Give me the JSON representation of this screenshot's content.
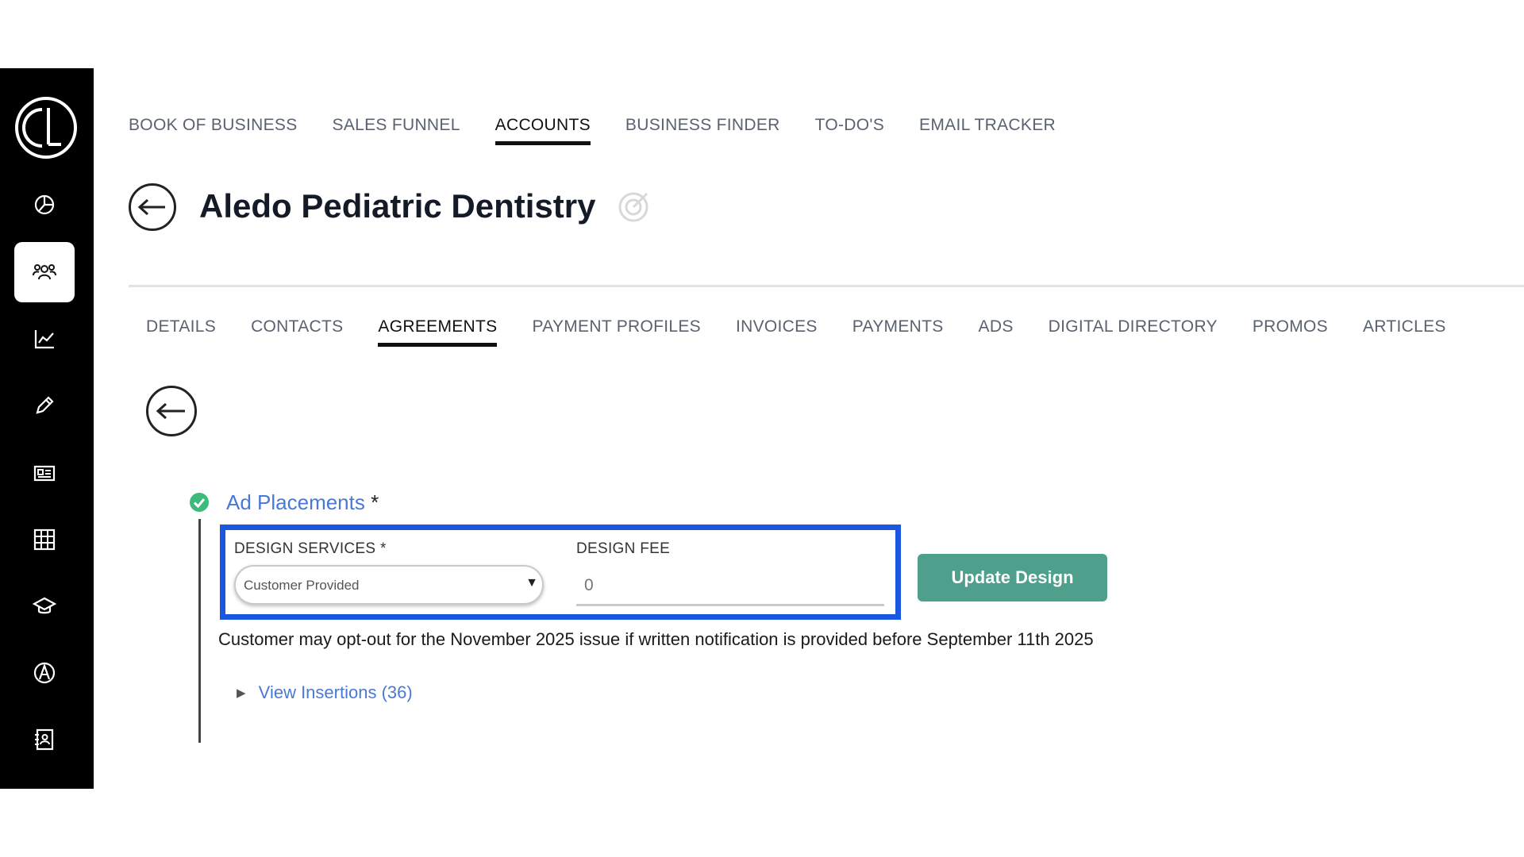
{
  "sidebar": {
    "logo_text": "CL",
    "items": [
      {
        "icon": "pie-chart-icon",
        "active": false
      },
      {
        "icon": "users-icon",
        "active": true
      },
      {
        "icon": "line-chart-icon",
        "active": false
      },
      {
        "icon": "pencil-icon",
        "active": false
      },
      {
        "icon": "newspaper-icon",
        "active": false
      },
      {
        "icon": "grid-icon",
        "active": false
      },
      {
        "icon": "graduation-cap-icon",
        "active": false
      },
      {
        "icon": "compass-icon",
        "active": false
      },
      {
        "icon": "contact-book-icon",
        "active": false
      }
    ]
  },
  "top_nav": {
    "items": [
      "BOOK OF BUSINESS",
      "SALES FUNNEL",
      "ACCOUNTS",
      "BUSINESS FINDER",
      "TO-DO'S",
      "EMAIL TRACKER"
    ],
    "active": "ACCOUNTS"
  },
  "header": {
    "title": "Aledo Pediatric Dentistry"
  },
  "sub_nav": {
    "items": [
      "DETAILS",
      "CONTACTS",
      "AGREEMENTS",
      "PAYMENT PROFILES",
      "INVOICES",
      "PAYMENTS",
      "ADS",
      "DIGITAL DIRECTORY",
      "PROMOS",
      "ARTICLES"
    ],
    "active": "AGREEMENTS"
  },
  "section": {
    "title": "Ad Placements",
    "required_mark": "*",
    "design_services_label": "DESIGN SERVICES *",
    "design_services_value": "Customer Provided",
    "design_fee_label": "DESIGN FEE",
    "design_fee_placeholder": "0",
    "update_button_label": "Update Design",
    "notice": "Customer may opt-out for the November 2025 issue if written notification is provided before September 11th 2025",
    "view_insertions_label": "View Insertions (36)"
  },
  "colors": {
    "sidebar_bg": "#000000",
    "link": "#4a78d8",
    "button_bg": "#4e9f8c",
    "highlight_border": "#1b56e0",
    "check": "#3dba7c"
  }
}
